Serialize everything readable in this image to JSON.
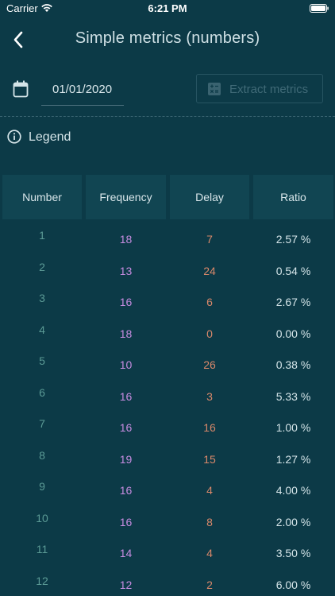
{
  "status": {
    "carrier": "Carrier",
    "time": "6:21 PM"
  },
  "nav": {
    "title": "Simple metrics (numbers)"
  },
  "toolbar": {
    "date": "01/01/2020",
    "extract_label": "Extract metrics"
  },
  "legend": {
    "label": "Legend"
  },
  "table": {
    "headers": [
      "Number",
      "Frequency",
      "Delay",
      "Ratio"
    ],
    "rows": [
      {
        "number": "1",
        "frequency": "18",
        "delay": "7",
        "ratio": "2.57 %"
      },
      {
        "number": "2",
        "frequency": "13",
        "delay": "24",
        "ratio": "0.54 %"
      },
      {
        "number": "3",
        "frequency": "16",
        "delay": "6",
        "ratio": "2.67 %"
      },
      {
        "number": "4",
        "frequency": "18",
        "delay": "0",
        "ratio": "0.00 %"
      },
      {
        "number": "5",
        "frequency": "10",
        "delay": "26",
        "ratio": "0.38 %"
      },
      {
        "number": "6",
        "frequency": "16",
        "delay": "3",
        "ratio": "5.33 %"
      },
      {
        "number": "7",
        "frequency": "16",
        "delay": "16",
        "ratio": "1.00 %"
      },
      {
        "number": "8",
        "frequency": "19",
        "delay": "15",
        "ratio": "1.27 %"
      },
      {
        "number": "9",
        "frequency": "16",
        "delay": "4",
        "ratio": "4.00 %"
      },
      {
        "number": "10",
        "frequency": "16",
        "delay": "8",
        "ratio": "2.00 %"
      },
      {
        "number": "11",
        "frequency": "14",
        "delay": "4",
        "ratio": "3.50 %"
      },
      {
        "number": "12",
        "frequency": "12",
        "delay": "2",
        "ratio": "6.00 %"
      }
    ]
  },
  "colors": {
    "background": "#0c3a47",
    "header_bg": "#114552",
    "number": "#5b9a95",
    "frequency": "#c68ce0",
    "delay": "#d9886a",
    "ratio": "#d4e4e8"
  },
  "icons": {
    "back": "chevron-left-icon",
    "calendar": "calendar-icon",
    "extract": "calculator-icon",
    "legend": "info-icon"
  }
}
